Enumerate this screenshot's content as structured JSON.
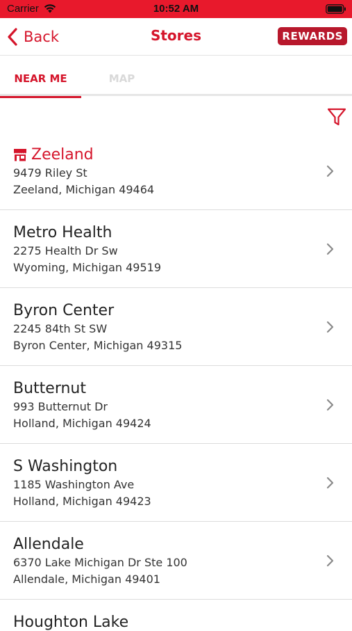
{
  "status_bar": {
    "carrier": "Carrier",
    "time": "10:52 AM",
    "icons": [
      "wifi-icon",
      "battery-icon"
    ]
  },
  "nav": {
    "back_label": "Back",
    "title": "Stores",
    "rewards_label": "REWARDS"
  },
  "tabs": [
    {
      "label": "NEAR ME",
      "active": true
    },
    {
      "label": "MAP",
      "active": false
    }
  ],
  "filter_icon": "filter-icon",
  "colors": {
    "accent": "#d5152b",
    "status_bar": "#e8192c",
    "rewards_bg": "#b8182c"
  },
  "stores": [
    {
      "name": "Zeeland",
      "address1": "9479 Riley St",
      "address2": "Zeeland, Michigan 49464",
      "current": true
    },
    {
      "name": "Metro Health",
      "address1": "2275 Health Dr Sw",
      "address2": "Wyoming, Michigan 49519"
    },
    {
      "name": "Byron Center",
      "address1": "2245 84th St SW",
      "address2": "Byron Center, Michigan 49315"
    },
    {
      "name": "Butternut",
      "address1": "993 Butternut Dr",
      "address2": "Holland, Michigan 49424"
    },
    {
      "name": "S Washington",
      "address1": "1185 Washington Ave",
      "address2": "Holland, Michigan 49423"
    },
    {
      "name": "Allendale",
      "address1": "6370 Lake Michigan Dr Ste 100",
      "address2": "Allendale, Michigan 49401"
    },
    {
      "name": "Houghton Lake"
    }
  ]
}
